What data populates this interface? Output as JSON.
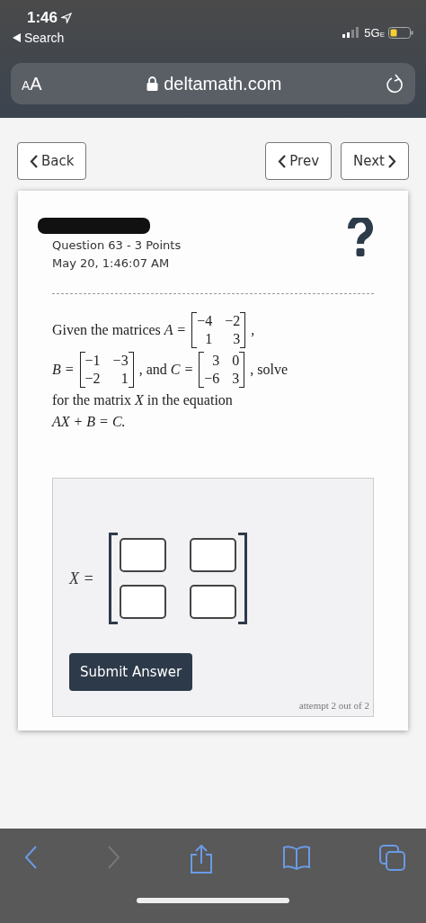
{
  "status_bar": {
    "time": "1:46",
    "back_label": "Search",
    "network": "5G",
    "network_sub": "E"
  },
  "address_bar": {
    "text_size_label": "AA",
    "url": "deltamath.com"
  },
  "nav_buttons": [
    {
      "kind": "back",
      "label": "Back"
    },
    {
      "kind": "prev",
      "label": "Prev"
    },
    {
      "kind": "next",
      "label": "Next"
    }
  ],
  "question": {
    "title": "Question 63 - 3 Points",
    "timestamp": "May 20, 1:46:07 AM",
    "lines": [
      [
        {
          "kind": "text",
          "text": "Given the matrices "
        },
        {
          "kind": "math",
          "text": "A ="
        },
        {
          "kind": "matrix",
          "rows": [
            [
              "−4",
              "−2"
            ],
            [
              "1",
              "3"
            ]
          ]
        },
        {
          "kind": "text",
          "text": ","
        }
      ],
      [
        {
          "kind": "math",
          "text": "B ="
        },
        {
          "kind": "matrix",
          "rows": [
            [
              "−1",
              "−3"
            ],
            [
              "−2",
              "1"
            ]
          ]
        },
        {
          "kind": "text",
          "text": ", and "
        },
        {
          "kind": "math",
          "text": "C ="
        },
        {
          "kind": "matrix",
          "rows": [
            [
              "3",
              "0"
            ],
            [
              "−6",
              "3"
            ]
          ]
        },
        {
          "kind": "text",
          "text": ", solve"
        }
      ],
      [
        {
          "kind": "text",
          "text": "for the matrix "
        },
        {
          "kind": "math",
          "text": "X"
        },
        {
          "kind": "text",
          "text": " in the equation"
        }
      ],
      [
        {
          "kind": "math",
          "text": "AX + B = C."
        }
      ]
    ]
  },
  "answer": {
    "label": "X =",
    "cells": [
      [
        {
          "kind": "input"
        },
        {
          "kind": "input"
        }
      ],
      [
        {
          "kind": "input"
        },
        {
          "kind": "input"
        }
      ]
    ],
    "submit_label": "Submit Answer",
    "attempt": "attempt 2 out of 2"
  }
}
